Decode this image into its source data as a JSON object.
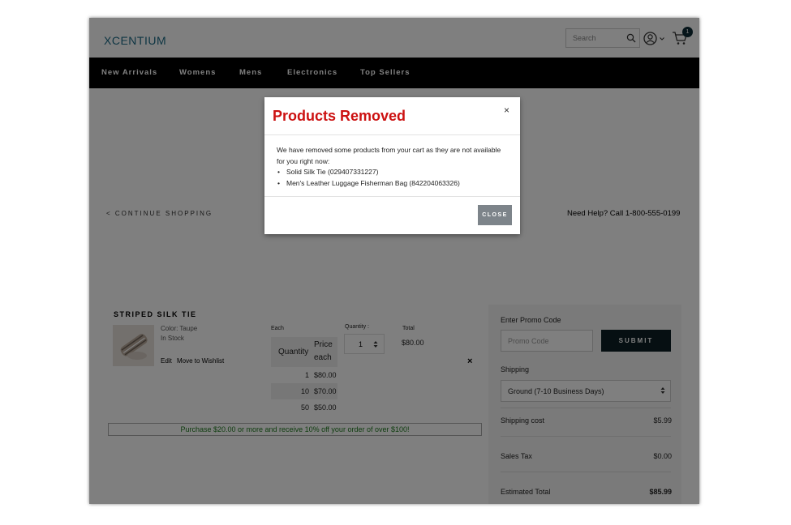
{
  "header": {
    "logo": "XCENTIUM",
    "search_placeholder": "Search",
    "cart_count": "1",
    "icons": {
      "search": "search-icon",
      "account": "user-icon",
      "dropdown": "chevron-down-icon",
      "cart": "cart-icon"
    }
  },
  "nav": {
    "items": [
      "New Arrivals",
      "Womens",
      "Mens",
      "Electronics",
      "Top Sellers"
    ]
  },
  "page": {
    "continue_shopping": "< CONTINUE SHOPPING",
    "help": "Need Help? Call 1-800-555-0199"
  },
  "cart_item": {
    "name": "STRIPED SILK TIE",
    "color": "Color: Taupe",
    "stock": "In Stock",
    "edit": "Edit",
    "move_wishlist": "Move to Wishlist",
    "each_label": "Each",
    "quantity_label": "Quantity :",
    "total_label": "Total",
    "price_table": {
      "header_qty": "Quantity",
      "header_price_1": "Price",
      "header_price_2": "each",
      "rows": [
        {
          "qty": "1",
          "price": "$80.00"
        },
        {
          "qty": "10",
          "price": "$70.00"
        },
        {
          "qty": "50",
          "price": "$50.00"
        }
      ]
    },
    "quantity_value": "1",
    "total_value": "$80.00",
    "remove": "×"
  },
  "promo_banner": "Purchase $20.00 or more and receive 10% off your order of over $100!",
  "summary": {
    "promo_label": "Enter Promo Code",
    "promo_placeholder": "Promo Code",
    "submit": "SUBMIT",
    "shipping_label": "Shipping",
    "shipping_option": "Ground (7-10 Business Days)",
    "shipping_cost_label": "Shipping cost",
    "shipping_cost": "$5.99",
    "sales_tax_label": "Sales Tax",
    "sales_tax": "$0.00",
    "estimated_total_label": "Estimated Total",
    "estimated_total": "$85.99"
  },
  "modal": {
    "title": "Products Removed",
    "close_x": "×",
    "message": "We have removed some products from your cart as they are not available for you right now:",
    "items": [
      "Solid Silk Tie (029407331227)",
      "Men's Leather Luggage Fisherman Bag (842204063326)"
    ],
    "close_button": "CLOSE"
  },
  "colors": {
    "modal_title": "#cc1111",
    "nav_bg": "#000000",
    "promo_text": "#1e7a1e",
    "submit_bg": "#0d1f24",
    "close_btn_bg": "#7d848a",
    "logo": "#1b6a86"
  }
}
